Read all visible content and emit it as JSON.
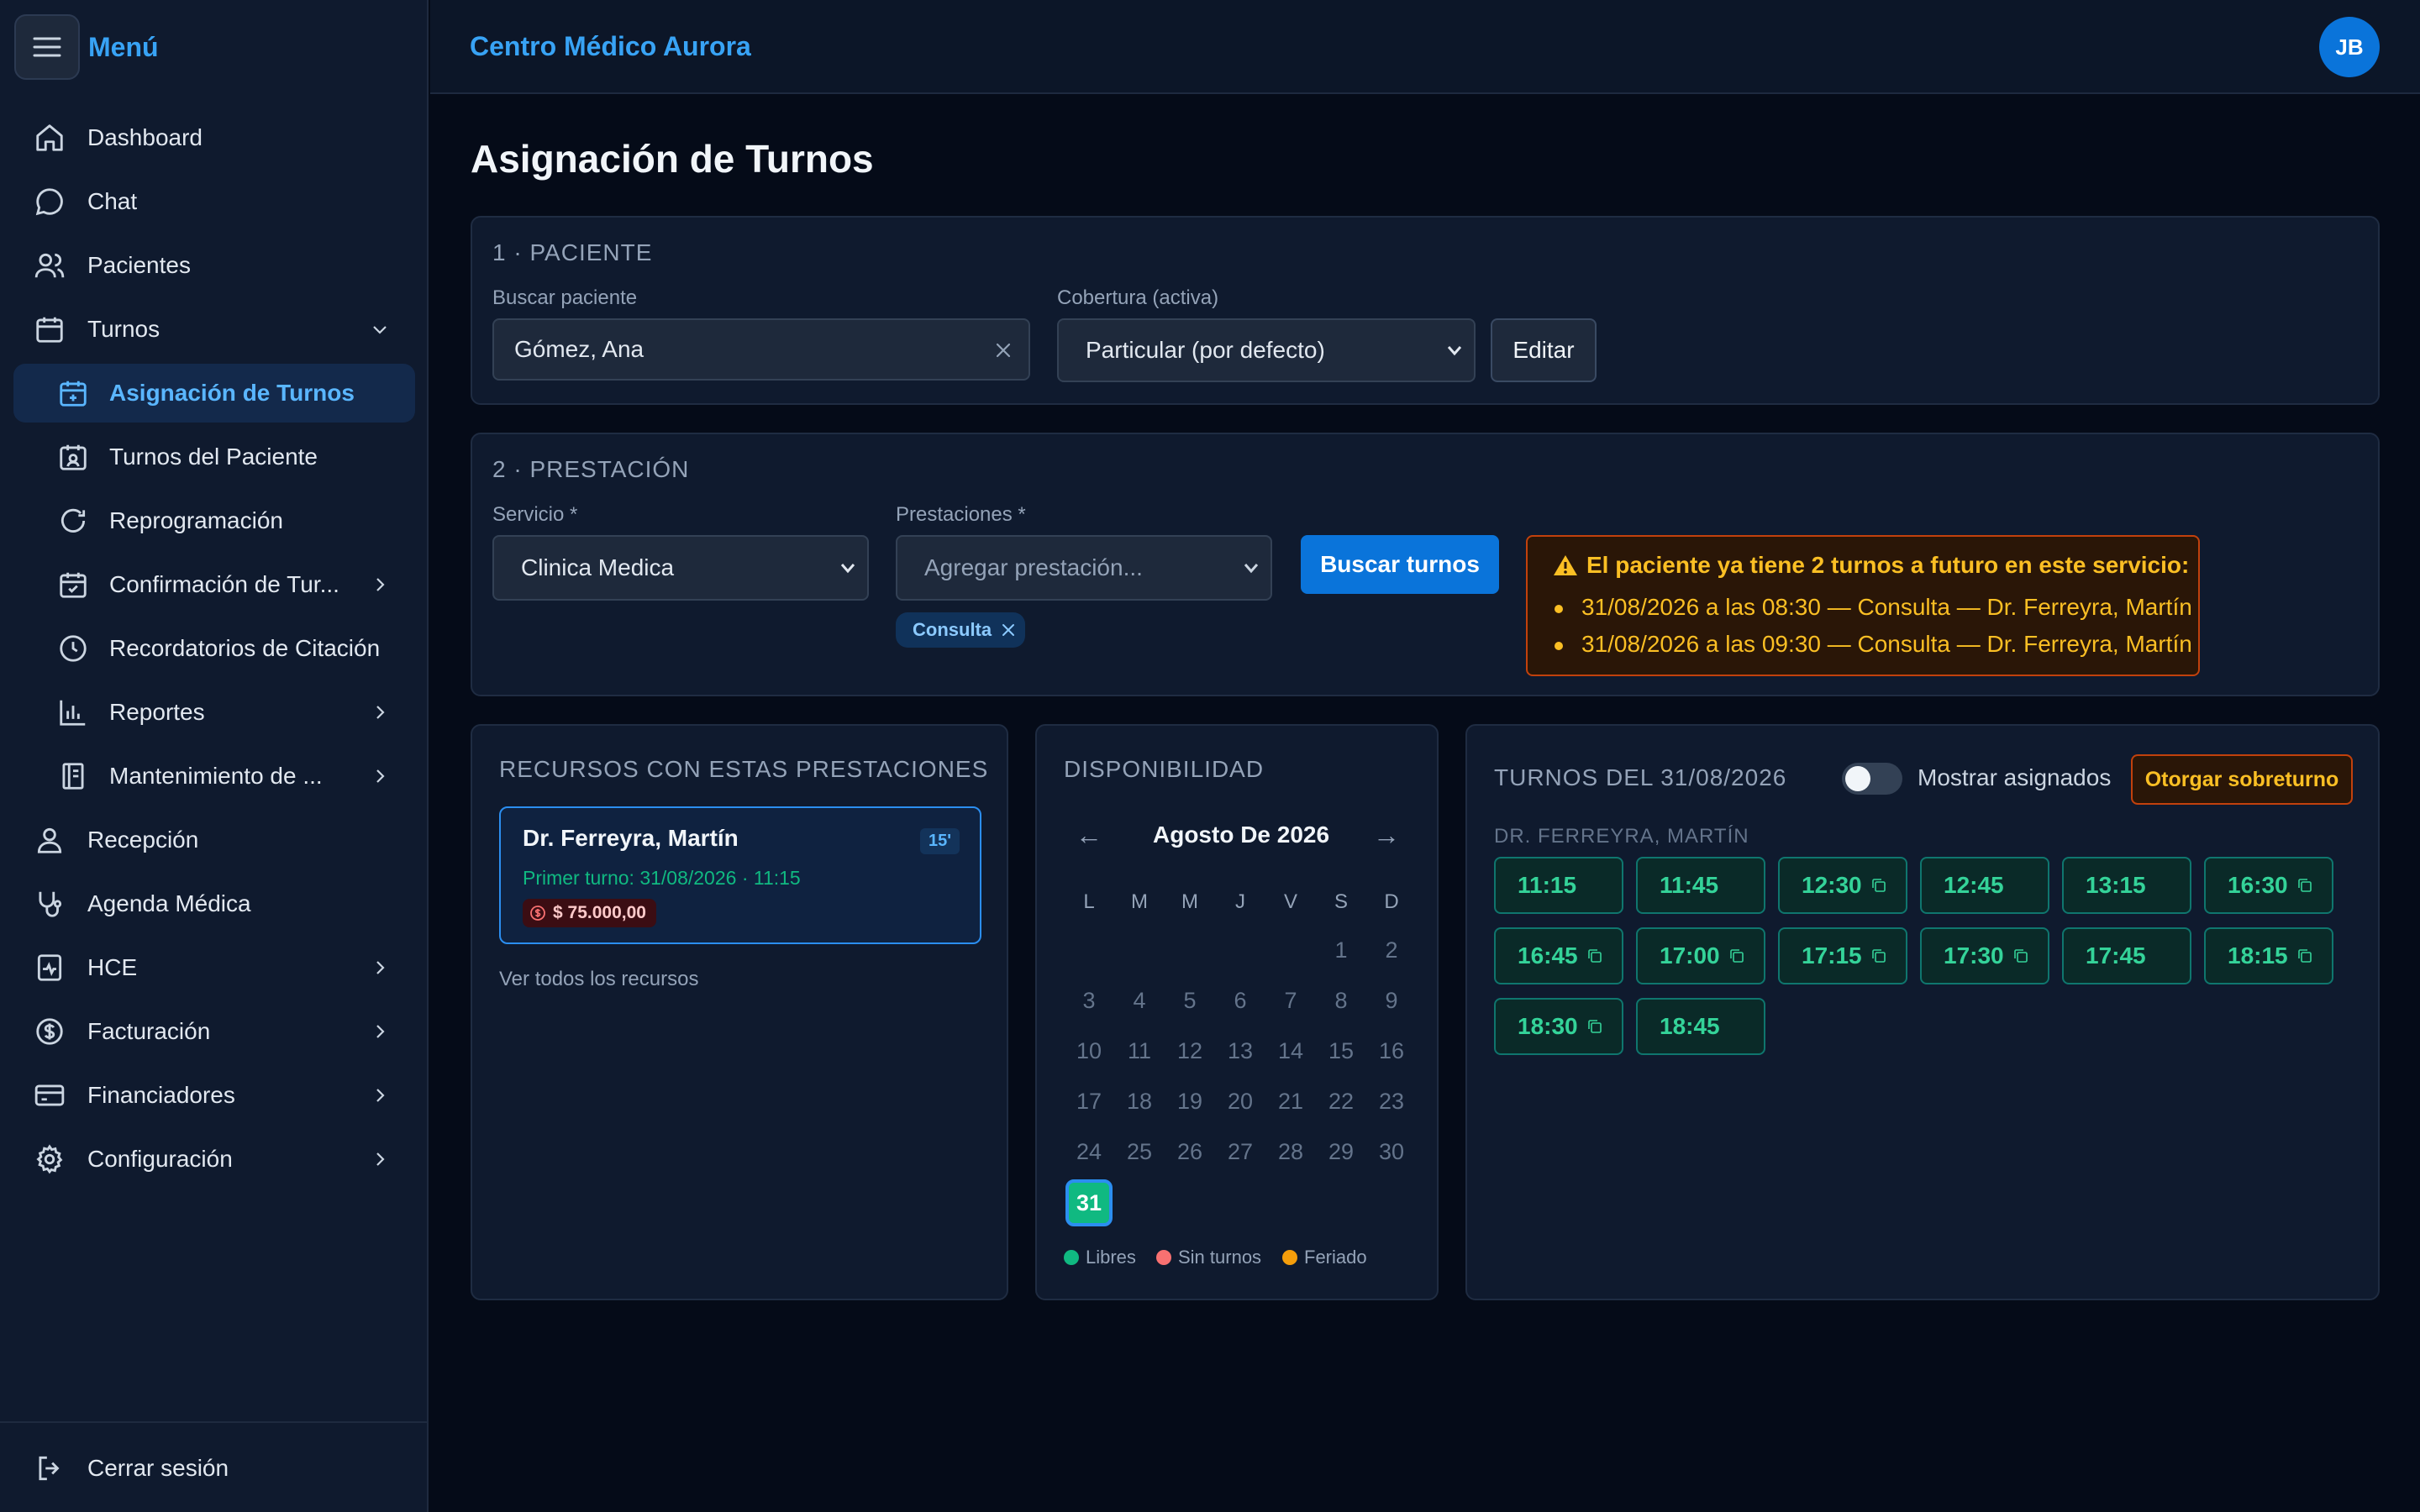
{
  "sidebar": {
    "menu_title": "Menú",
    "items": [
      {
        "label": "Dashboard"
      },
      {
        "label": "Chat"
      },
      {
        "label": "Pacientes"
      },
      {
        "label": "Turnos"
      },
      {
        "label": "Asignación de Turnos"
      },
      {
        "label": "Turnos del Paciente"
      },
      {
        "label": "Reprogramación"
      },
      {
        "label": "Confirmación de Tur..."
      },
      {
        "label": "Recordatorios de Citación"
      },
      {
        "label": "Reportes"
      },
      {
        "label": "Mantenimiento de ..."
      },
      {
        "label": "Recepción"
      },
      {
        "label": "Agenda Médica"
      },
      {
        "label": "HCE"
      },
      {
        "label": "Facturación"
      },
      {
        "label": "Financiadores"
      },
      {
        "label": "Configuración"
      }
    ],
    "logout_label": "Cerrar sesión"
  },
  "header": {
    "brand": "Centro Médico Aurora",
    "avatar_initials": "JB"
  },
  "page": {
    "title": "Asignación de Turnos"
  },
  "paciente": {
    "section_title": "1 · PACIENTE",
    "search_label": "Buscar paciente",
    "search_value": "Gómez, Ana",
    "coverage_label": "Cobertura (activa)",
    "coverage_value": "Particular (por defecto)",
    "edit_button": "Editar"
  },
  "prestacion": {
    "section_title": "2 · PRESTACIÓN",
    "service_label": "Servicio *",
    "service_value": "Clinica Medica",
    "prestaciones_label": "Prestaciones *",
    "prestaciones_placeholder": "Agregar prestación...",
    "tag": "Consulta",
    "search_button": "Buscar turnos",
    "warning": {
      "title": "El paciente ya tiene 2 turnos a futuro en este servicio:",
      "items": [
        "31/08/2026 a las 08:30 — Consulta — Dr. Ferreyra, Martín",
        "31/08/2026 a las 09:30 — Consulta — Dr. Ferreyra, Martín"
      ]
    }
  },
  "recursos": {
    "title": "RECURSOS CON ESTAS PRESTACIONES",
    "card": {
      "name": "Dr. Ferreyra, Martín",
      "duration": "15'",
      "first": "Primer turno: 31/08/2026 · 11:15",
      "price": "$ 75.000,00"
    },
    "see_all": "Ver todos los recursos"
  },
  "disponibilidad": {
    "title": "DISPONIBILIDAD",
    "prev": "←",
    "next": "→",
    "month": "Agosto De 2026",
    "weekdays": [
      "L",
      "M",
      "M",
      "J",
      "V",
      "S",
      "D"
    ],
    "days": [
      "1",
      "2",
      "3",
      "4",
      "5",
      "6",
      "7",
      "8",
      "9",
      "10",
      "11",
      "12",
      "13",
      "14",
      "15",
      "16",
      "17",
      "18",
      "19",
      "20",
      "21",
      "22",
      "23",
      "24",
      "25",
      "26",
      "27",
      "28",
      "29",
      "30",
      "31"
    ],
    "selected_day": "31",
    "legend": [
      {
        "label": "Libres",
        "color": "#10b981"
      },
      {
        "label": "Sin turnos",
        "color": "#f87171"
      },
      {
        "label": "Feriado",
        "color": "#f59e0b"
      }
    ]
  },
  "turnos": {
    "title": "TURNOS DEL 31/08/2026",
    "toggle_label": "Mostrar asignados",
    "toggle_on": false,
    "overbook_button": "Otorgar sobreturno",
    "doctor": "DR. FERREYRA, MARTÍN",
    "slots": [
      {
        "time": "11:15",
        "copy": false
      },
      {
        "time": "11:45",
        "copy": false
      },
      {
        "time": "12:30",
        "copy": true
      },
      {
        "time": "12:45",
        "copy": false
      },
      {
        "time": "13:15",
        "copy": false
      },
      {
        "time": "16:30",
        "copy": true
      },
      {
        "time": "16:45",
        "copy": true
      },
      {
        "time": "17:00",
        "copy": true
      },
      {
        "time": "17:15",
        "copy": true
      },
      {
        "time": "17:30",
        "copy": true
      },
      {
        "time": "17:45",
        "copy": false
      },
      {
        "time": "18:15",
        "copy": true
      },
      {
        "time": "18:30",
        "copy": true
      },
      {
        "time": "18:45",
        "copy": false
      }
    ]
  }
}
